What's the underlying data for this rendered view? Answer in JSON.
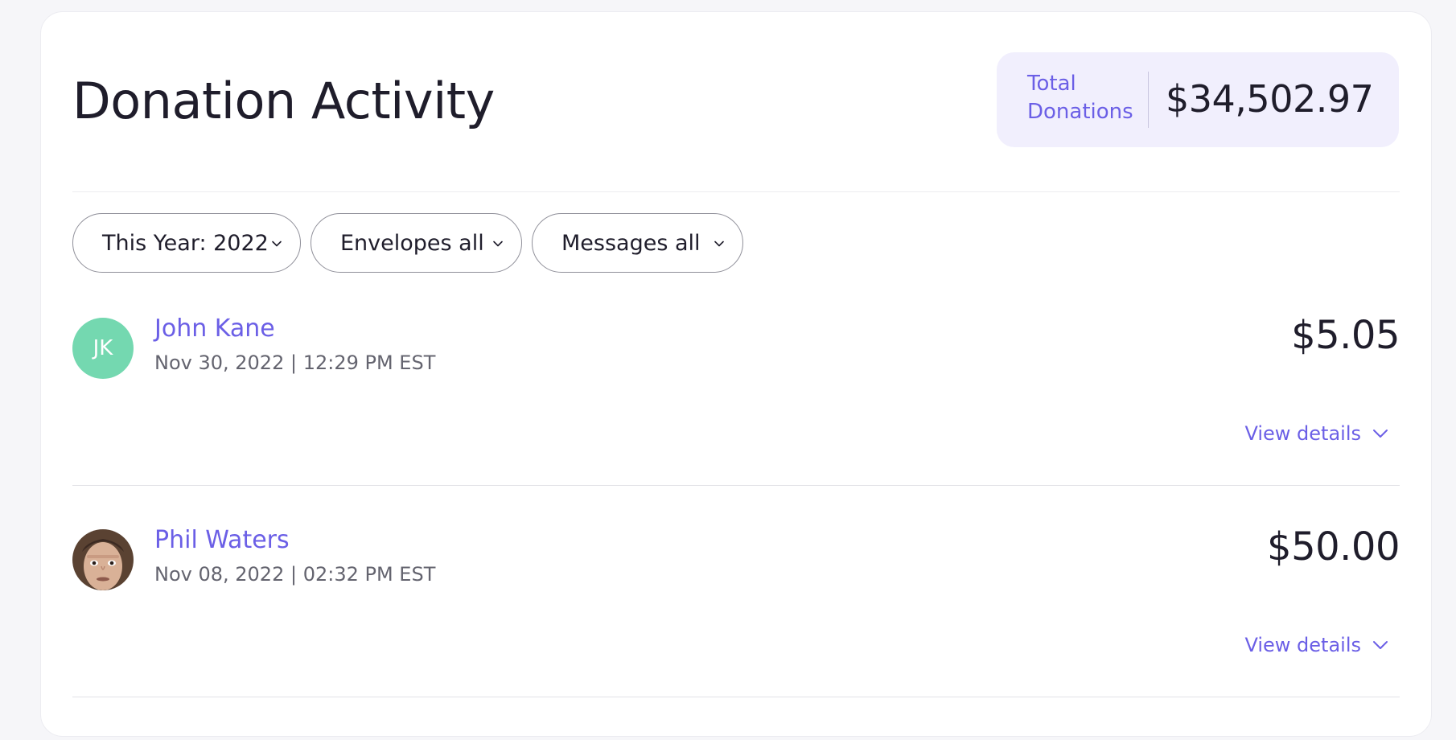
{
  "header": {
    "title": "Donation Activity",
    "total_label": "Total Donations",
    "total_value": "$34,502.97"
  },
  "filters": [
    {
      "label": "This Year: 2022"
    },
    {
      "label": "Envelopes all"
    },
    {
      "label": "Messages all"
    }
  ],
  "donations": [
    {
      "name": "John Kane",
      "initials": "JK",
      "date": "Nov 30, 2022 | 12:29 PM EST",
      "amount": "$5.05",
      "details_label": "View details"
    },
    {
      "name": "Phil Waters",
      "date": "Nov 08, 2022 | 02:32 PM EST",
      "amount": "$50.00",
      "details_label": "View details"
    }
  ],
  "colors": {
    "accent": "#6b5fe6",
    "total_bg": "#f1effd",
    "avatar_green": "#74d8b0",
    "text_dark": "#1f1d2b",
    "text_muted": "#64646f"
  },
  "icons": {
    "filter_chevron": "chevron-down-icon",
    "details_chevron": "chevron-down-icon"
  }
}
